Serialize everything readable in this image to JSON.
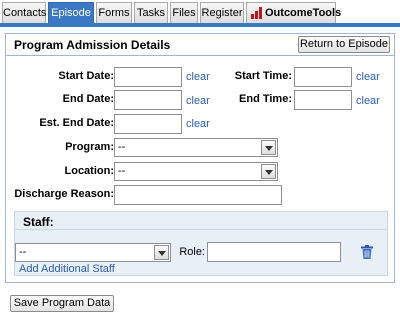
{
  "tabs": [
    {
      "label": "Contacts",
      "active": false
    },
    {
      "label": "Episode",
      "active": true
    },
    {
      "label": "Forms",
      "active": false
    },
    {
      "label": "Tasks",
      "active": false
    },
    {
      "label": "Files",
      "active": false
    },
    {
      "label": "Register",
      "active": false
    },
    {
      "label": "OutcomeTools",
      "active": false
    }
  ],
  "panel": {
    "title": "Program Admission Details",
    "return_button": "Return to Episode"
  },
  "form": {
    "start_date": {
      "label": "Start Date:",
      "value": "",
      "clear": "clear"
    },
    "start_time": {
      "label": "Start Time:",
      "value": "",
      "clear": "clear"
    },
    "end_date": {
      "label": "End Date:",
      "value": "",
      "clear": "clear"
    },
    "end_time": {
      "label": "End Time:",
      "value": "",
      "clear": "clear"
    },
    "est_end_date": {
      "label": "Est. End Date:",
      "value": "",
      "clear": "clear"
    },
    "program": {
      "label": "Program:",
      "selected": "--"
    },
    "location": {
      "label": "Location:",
      "selected": "--"
    },
    "discharge_reason": {
      "label": "Discharge Reason:",
      "value": ""
    }
  },
  "staff": {
    "title": "Staff:",
    "selected": "--",
    "role_label": "Role:",
    "role_value": "",
    "add_link": "Add Additional Staff",
    "delete_icon": "trash-icon"
  },
  "save_button": "Save Program Data",
  "colors": {
    "accent": "#3a78c3",
    "link": "#2a5db0",
    "staff_bg": "#e9eff7",
    "logo_red": "#c0161c"
  }
}
